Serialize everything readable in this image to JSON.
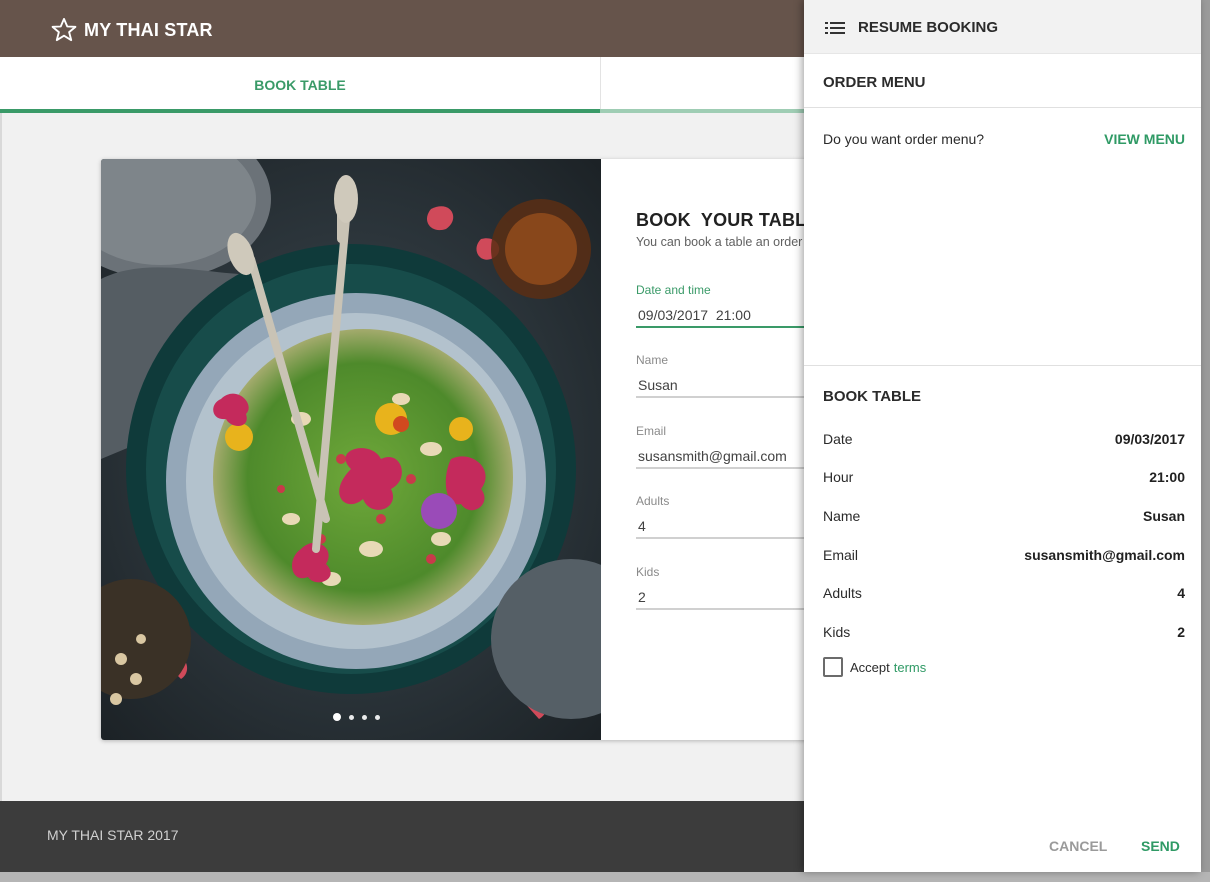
{
  "header": {
    "brand": "MY THAI STAR",
    "logo_icon": "star-outline-icon"
  },
  "tabs": [
    {
      "label": "BOOK TABLE",
      "active": true
    },
    {
      "label": "",
      "active": false
    }
  ],
  "booking_form": {
    "title": "BOOK  YOUR TABLE",
    "subtitle": "You can book a table an order",
    "fields": [
      {
        "label": "Date and time",
        "value": "09/03/2017  21:00"
      },
      {
        "label": "Name",
        "value": "Susan"
      },
      {
        "label": "Email",
        "value": "susansmith@gmail.com"
      },
      {
        "label": "Adults",
        "value": "4"
      },
      {
        "label": "Kids",
        "value": "2"
      }
    ]
  },
  "carousel": {
    "active_index": 0,
    "count": 4
  },
  "footer": {
    "text": "MY THAI STAR 2017"
  },
  "panel": {
    "title": "RESUME BOOKING",
    "title_icon": "list-icon",
    "order_menu": {
      "title": "ORDER MENU",
      "question": "Do you want order menu?",
      "action": "VIEW MENU"
    },
    "book_table": {
      "title": "BOOK TABLE",
      "rows": [
        {
          "key": "Date",
          "value": "09/03/2017"
        },
        {
          "key": "Hour",
          "value": "21:00"
        },
        {
          "key": "Name",
          "value": "Susan"
        },
        {
          "key": "Email",
          "value": "susansmith@gmail.com"
        },
        {
          "key": "Adults",
          "value": "4"
        },
        {
          "key": "Kids",
          "value": "2"
        }
      ]
    },
    "accept_label": "Accept",
    "terms_label": "terms",
    "accept_checked": false,
    "cancel_label": "CANCEL",
    "send_label": "SEND"
  },
  "colors": {
    "brand_bar": "#66544b",
    "accent": "#3a9a68",
    "footer": "#3c3c3c"
  }
}
